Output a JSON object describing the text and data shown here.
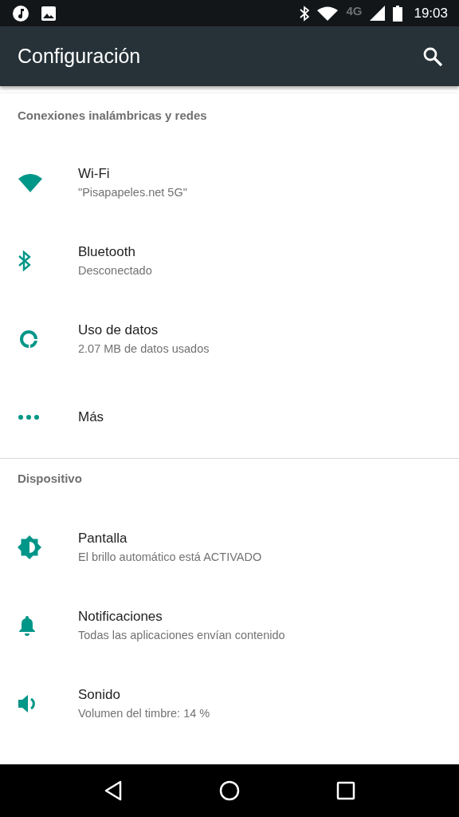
{
  "status_bar": {
    "network": "4G",
    "time": "19:03"
  },
  "app_bar": {
    "title": "Configuración"
  },
  "sections": [
    {
      "header": "Conexiones inalámbricas y redes",
      "items": [
        {
          "kind": "wifi",
          "title": "Wi-Fi",
          "subtitle": "\"Pisapapeles.net 5G\""
        },
        {
          "kind": "bluetooth",
          "title": "Bluetooth",
          "subtitle": "Desconectado"
        },
        {
          "kind": "data",
          "title": "Uso de datos",
          "subtitle": "2.07 MB de datos usados"
        },
        {
          "kind": "more",
          "title": "Más"
        }
      ]
    },
    {
      "header": "Dispositivo",
      "items": [
        {
          "kind": "display",
          "title": "Pantalla",
          "subtitle": "El brillo automático está ACTIVADO"
        },
        {
          "kind": "bell",
          "title": "Notificaciones",
          "subtitle": "Todas las aplicaciones envían contenido"
        },
        {
          "kind": "sound",
          "title": "Sonido",
          "subtitle": "Volumen del timbre: 14 %"
        }
      ]
    }
  ]
}
